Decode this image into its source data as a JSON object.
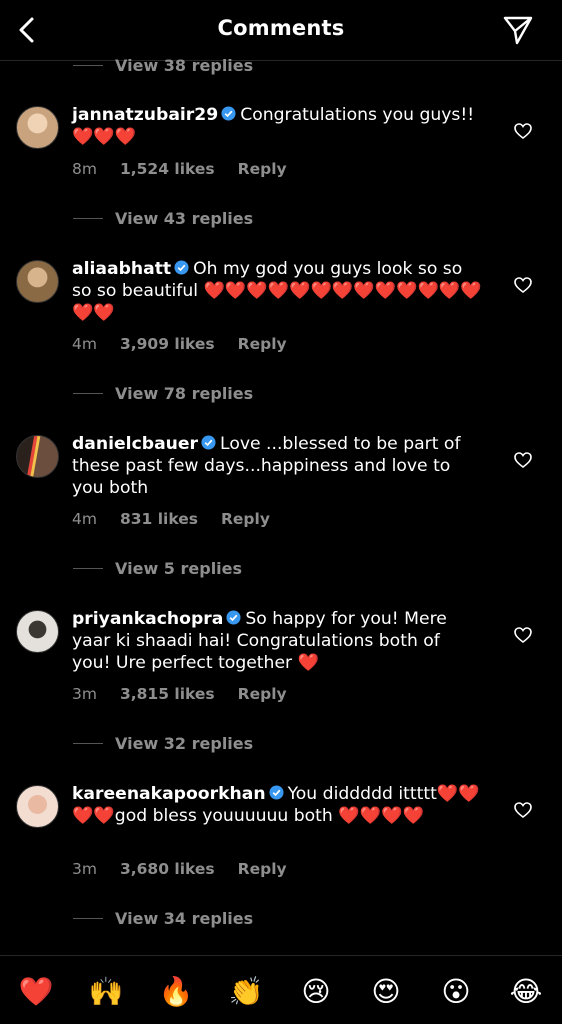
{
  "header": {
    "title": "Comments"
  },
  "top_view_replies": "View 38 replies",
  "comments": [
    {
      "username": "jannatzubair29",
      "text": "Congratulations you guys!! ❤️❤️❤️",
      "time": "8m",
      "likes": "1,524 likes",
      "reply": "Reply",
      "view_replies": "View 43 replies",
      "avatar_color": "#c9a27e"
    },
    {
      "username": "aliaabhatt",
      "text": "Oh my god you guys look so so so so beautiful ❤️❤️❤️❤️❤️❤️❤️❤️❤️❤️❤️❤️❤️❤️❤️",
      "time": "4m",
      "likes": "3,909 likes",
      "reply": "Reply",
      "view_replies": "View 78 replies",
      "avatar_color": "#9c7a52"
    },
    {
      "username": "danielcbauer",
      "text": "Love ...blessed to be part of these past few days...happiness and love to you both",
      "time": "4m",
      "likes": "831 likes",
      "reply": "Reply",
      "view_replies": "View 5 replies",
      "avatar_color": "#4a3a30"
    },
    {
      "username": "priyankachopra",
      "text": "So happy for you! Mere yaar ki shaadi hai! Congratulations both of you! Ure perfect together ❤️",
      "time": "3m",
      "likes": "3,815 likes",
      "reply": "Reply",
      "view_replies": "View 32 replies",
      "avatar_color": "#d9d6d0"
    },
    {
      "username": "kareenakapoorkhan",
      "text": "You diddddd ittttt❤️❤️❤️❤️god bless youuuuuu both ❤️❤️❤️❤️",
      "time": "3m",
      "likes": "3,680 likes",
      "reply": "Reply",
      "view_replies": "View 34 replies",
      "avatar_color": "#e2b7a4"
    }
  ],
  "colors": {
    "background": "#000000",
    "secondary_text": "#8e8e8e",
    "verified": "#3897f0",
    "heart": "#ed2c3e"
  },
  "emoji_bar": [
    "❤️",
    "🙌",
    "🔥",
    "👏",
    "😢",
    "😍",
    "😮",
    "😂"
  ]
}
